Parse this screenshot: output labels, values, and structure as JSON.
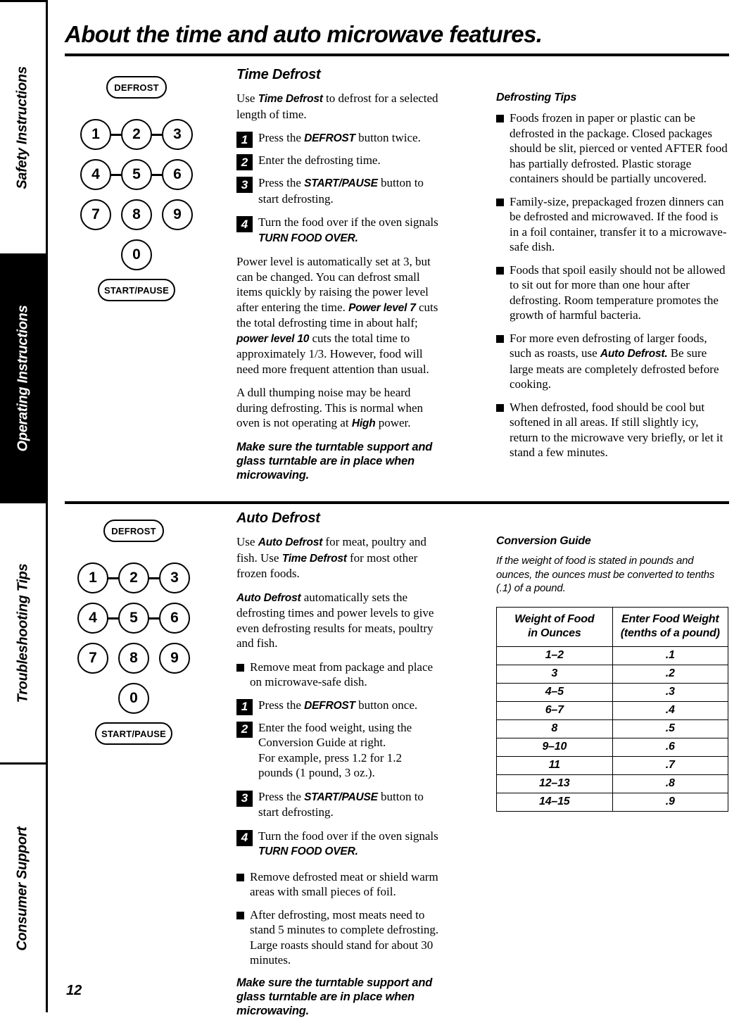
{
  "sidebar": {
    "tabs": [
      {
        "label": "Safety Instructions",
        "active": false
      },
      {
        "label": "Operating Instructions",
        "active": true
      },
      {
        "label": "Troubleshooting Tips",
        "active": false
      },
      {
        "label": "Consumer Support",
        "active": false
      }
    ]
  },
  "page": {
    "title": "About the time and auto microwave features.",
    "number": "12"
  },
  "keypad": {
    "defrost_label": "DEFROST",
    "start_pause_label": "START/PAUSE",
    "keys": [
      "1",
      "2",
      "3",
      "4",
      "5",
      "6",
      "7",
      "8",
      "9",
      "0"
    ]
  },
  "time_defrost": {
    "heading": "Time Defrost",
    "intro_pre": "Use ",
    "intro_em": "Time Defrost",
    "intro_post": " to defrost for a selected length of time.",
    "steps": [
      {
        "num": "1",
        "pre": "Press the ",
        "em": "DEFROST",
        "post": " button twice."
      },
      {
        "num": "2",
        "pre": "Enter the defrosting time.",
        "em": "",
        "post": ""
      },
      {
        "num": "3",
        "pre": "Press the ",
        "em": "START/PAUSE",
        "post": " button to start defrosting."
      },
      {
        "num": "4",
        "pre": "Turn the food over if the oven signals ",
        "em": "TURN FOOD OVER.",
        "post": ""
      }
    ],
    "para_power_1": "Power level is automatically set at 3, but can be changed. You can defrost small items quickly by raising the power level after entering the time. ",
    "para_power_em1": "Power level 7",
    "para_power_2": " cuts the total defrosting time in about half; ",
    "para_power_em2": "power level 10",
    "para_power_3": " cuts the total time to approximately 1/3. However, food will need more frequent attention than usual.",
    "para_noise_1": "A dull thumping noise may be heard during defrosting. This is normal when oven is not operating at ",
    "para_noise_em": "High",
    "para_noise_2": " power.",
    "turntable_note": "Make sure the turntable support and glass turntable are in place when microwaving."
  },
  "defrosting_tips": {
    "heading": "Defrosting Tips",
    "bullets": [
      {
        "pre": "Foods frozen in paper or plastic can be defrosted in the package. Closed packages should be slit, pierced or vented AFTER food has partially defrosted. Plastic storage containers should be partially uncovered.",
        "em": "",
        "post": ""
      },
      {
        "pre": "Family-size, prepackaged frozen dinners can be defrosted and microwaved. If the food is in a foil container, transfer it to a microwave-safe dish.",
        "em": "",
        "post": ""
      },
      {
        "pre": "Foods that spoil easily should not be allowed to sit out for more than one hour after defrosting. Room temperature promotes the growth of harmful bacteria.",
        "em": "",
        "post": ""
      },
      {
        "pre": "For more even defrosting of larger foods, such as roasts, use ",
        "em": "Auto Defrost.",
        "post": " Be sure large meats are completely defrosted before cooking."
      },
      {
        "pre": "When defrosted, food should be cool but softened in all areas. If still slightly icy, return to the microwave very briefly, or let it stand a few minutes.",
        "em": "",
        "post": ""
      }
    ]
  },
  "auto_defrost": {
    "heading": "Auto Defrost",
    "intro_a_pre": "Use ",
    "intro_a_em": "Auto Defrost",
    "intro_a_post": "  for meat, poultry and fish. ",
    "intro_b_pre": "Use ",
    "intro_b_em": "Time Defrost",
    "intro_b_post": " for most other frozen foods.",
    "para_auto_em": "Auto Defrost",
    "para_auto_post": "  automatically sets the defrosting times and power levels to give even defrosting results for meats, poultry and fish.",
    "bullet_remove_meat": "Remove meat from package and place on microwave-safe dish.",
    "steps": [
      {
        "num": "1",
        "pre": "Press the ",
        "em": "DEFROST",
        "post": " button once."
      },
      {
        "num": "2",
        "pre": "Enter the food weight, using the Conversion Guide at right.\nFor example, press 1.2 for 1.2 pounds (1 pound, 3 oz.).",
        "em": "",
        "post": ""
      },
      {
        "num": "3",
        "pre": "Press the ",
        "em": "START/PAUSE",
        "post": " button to start defrosting."
      },
      {
        "num": "4",
        "pre": "Turn the food over if the oven signals ",
        "em": "TURN FOOD OVER.",
        "post": ""
      }
    ],
    "bullets_after": [
      "Remove defrosted meat or shield warm areas with small pieces of foil.",
      "After defrosting, most meats need to stand 5 minutes to complete defrosting. Large roasts should stand for about 30 minutes."
    ],
    "turntable_note": "Make sure the turntable support and glass turntable are in place when microwaving."
  },
  "conversion_guide": {
    "heading": "Conversion Guide",
    "intro": "If the weight of food is stated in pounds and ounces, the ounces must be converted to tenths (.1) of a pound.",
    "table": {
      "headers": [
        {
          "line1": "Weight of Food",
          "line2": "in Ounces"
        },
        {
          "line1": "Enter Food Weight",
          "line2": "(tenths of a pound)"
        }
      ],
      "rows": [
        [
          "1–2",
          ".1"
        ],
        [
          "3",
          ".2"
        ],
        [
          "4–5",
          ".3"
        ],
        [
          "6–7",
          ".4"
        ],
        [
          "8",
          ".5"
        ],
        [
          "9–10",
          ".6"
        ],
        [
          "11",
          ".7"
        ],
        [
          "12–13",
          ".8"
        ],
        [
          "14–15",
          ".9"
        ]
      ]
    }
  },
  "colors": {
    "ink": "#000000",
    "paper": "#ffffff",
    "active_tab_bg": "#000000",
    "active_tab_fg": "#ffffff"
  }
}
